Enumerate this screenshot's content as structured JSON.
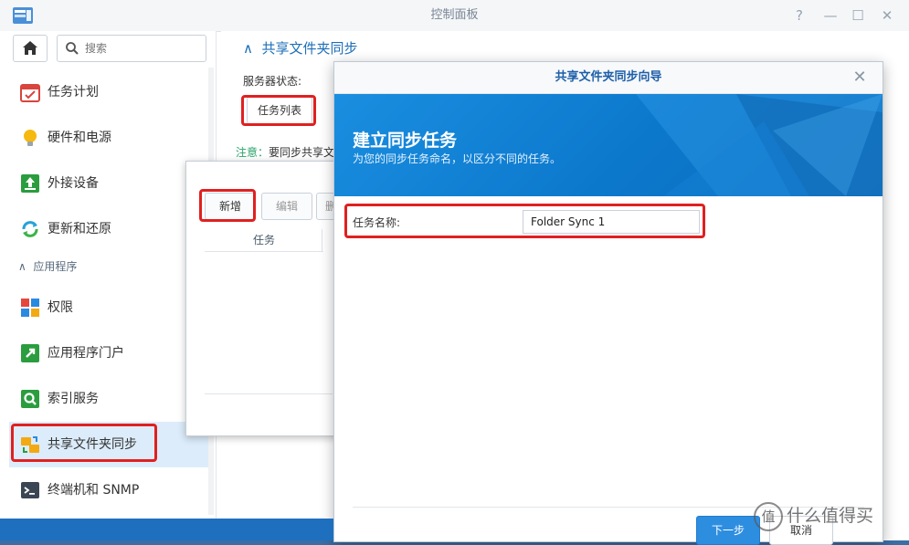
{
  "window": {
    "title": "控制面板"
  },
  "titlebar_buttons": {
    "help": "?",
    "minimize": "—",
    "maximize": "☐",
    "close": "✕"
  },
  "sidebar": {
    "search_placeholder": "搜索",
    "section_apps": "应用程序",
    "items": [
      {
        "label": "任务计划",
        "icon": "calendar-check-icon"
      },
      {
        "label": "硬件和电源",
        "icon": "lightbulb-icon"
      },
      {
        "label": "外接设备",
        "icon": "external-device-icon"
      },
      {
        "label": "更新和还原",
        "icon": "refresh-icon"
      },
      {
        "label": "权限",
        "icon": "privileges-icon"
      },
      {
        "label": "应用程序门户",
        "icon": "app-portal-icon"
      },
      {
        "label": "索引服务",
        "icon": "indexing-icon"
      },
      {
        "label": "共享文件夹同步",
        "icon": "folder-sync-icon",
        "active": true
      },
      {
        "label": "终端机和 SNMP",
        "icon": "terminal-icon"
      }
    ]
  },
  "content": {
    "header": "共享文件夹同步",
    "server_status_label": "服务器状态:",
    "task_list_button": "任务列表",
    "note_key": "注意：",
    "note_text": "要同步共享文"
  },
  "task_dialog": {
    "add_button": "新增",
    "edit_button": "编辑",
    "delete_button": "删",
    "column_task": "任务"
  },
  "wizard": {
    "title": "共享文件夹同步向导",
    "heading": "建立同步任务",
    "subheading": "为您的同步任务命名，以区分不同的任务。",
    "field_label": "任务名称:",
    "task_name_value": "Folder Sync 1",
    "next_button": "下一步",
    "cancel_button": "取消"
  },
  "watermark": {
    "badge": "值",
    "text": "什么值得买"
  },
  "colors": {
    "accent": "#1d6fb8",
    "highlight": "#e02020",
    "banner": "#0c78cc"
  }
}
